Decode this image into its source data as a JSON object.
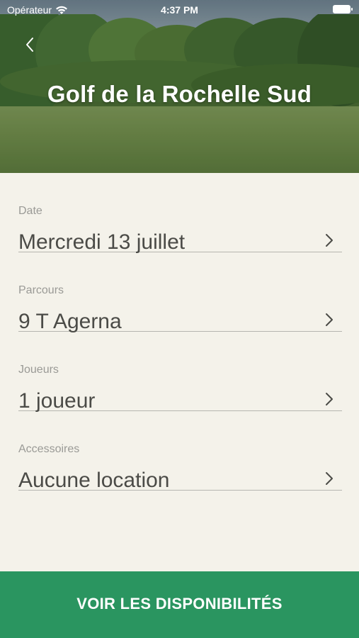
{
  "status_bar": {
    "carrier": "Opérateur",
    "time": "4:37 PM"
  },
  "header": {
    "title": "Golf de la Rochelle Sud",
    "back_icon": "chevron-left-icon"
  },
  "form": {
    "rows": [
      {
        "label": "Date",
        "value": "Mercredi 13 juillet",
        "icon": "chevron-right-icon"
      },
      {
        "label": "Parcours",
        "value": "9 T Agerna",
        "icon": "chevron-right-icon"
      },
      {
        "label": "Joueurs",
        "value": "1 joueur",
        "icon": "chevron-right-icon"
      },
      {
        "label": "Accessoires",
        "value": "Aucune location",
        "icon": "chevron-right-icon"
      }
    ]
  },
  "cta": {
    "label": "VOIR LES DISPONIBILITÉS"
  },
  "colors": {
    "background": "#f4f2ea",
    "accent": "#2a9560",
    "divider": "#b6b6b0",
    "label": "#9a9a96",
    "value": "#4b4b47"
  }
}
